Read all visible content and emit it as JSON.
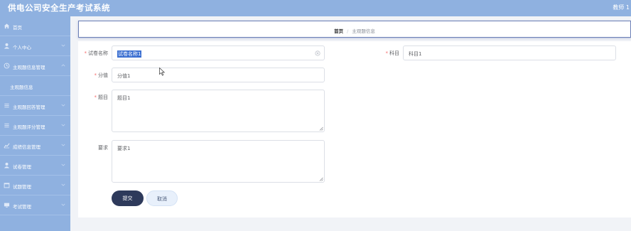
{
  "app": {
    "title": "供电公司安全生产考试系统",
    "user": "教师 1"
  },
  "sidebar": {
    "items": [
      {
        "label": "首页",
        "icon": "home-icon"
      },
      {
        "label": "个人中心",
        "icon": "user-icon"
      },
      {
        "label": "主观题信息管理",
        "icon": "clock-icon"
      },
      {
        "label": "主观题信息",
        "icon": ""
      },
      {
        "label": "主观题回答管理",
        "icon": "list-icon"
      },
      {
        "label": "主观题评分管理",
        "icon": "list-icon"
      },
      {
        "label": "成绩信息管理",
        "icon": "chart-icon"
      },
      {
        "label": "试卷管理",
        "icon": "user-icon"
      },
      {
        "label": "试题管理",
        "icon": "calendar-icon"
      },
      {
        "label": "考试管理",
        "icon": "monitor-icon"
      }
    ]
  },
  "breadcrumb": {
    "home": "首页",
    "separator": "/",
    "current": "主观题信息"
  },
  "form": {
    "paper_label": "试卷名称",
    "paper_value": "试卷名称1",
    "subject_label": "科目",
    "subject_value": "科目1",
    "score_label": "分值",
    "score_value": "分值1",
    "question_label": "题目",
    "question_value": "题目1",
    "requirement_label": "要求",
    "requirement_value": "要求1",
    "required_mark": "*",
    "submit_label": "提交",
    "cancel_label": "取消"
  },
  "colors": {
    "sidebar": "#8fb1e0",
    "primary_button": "#2e3a5b",
    "required": "#f56c6c"
  }
}
